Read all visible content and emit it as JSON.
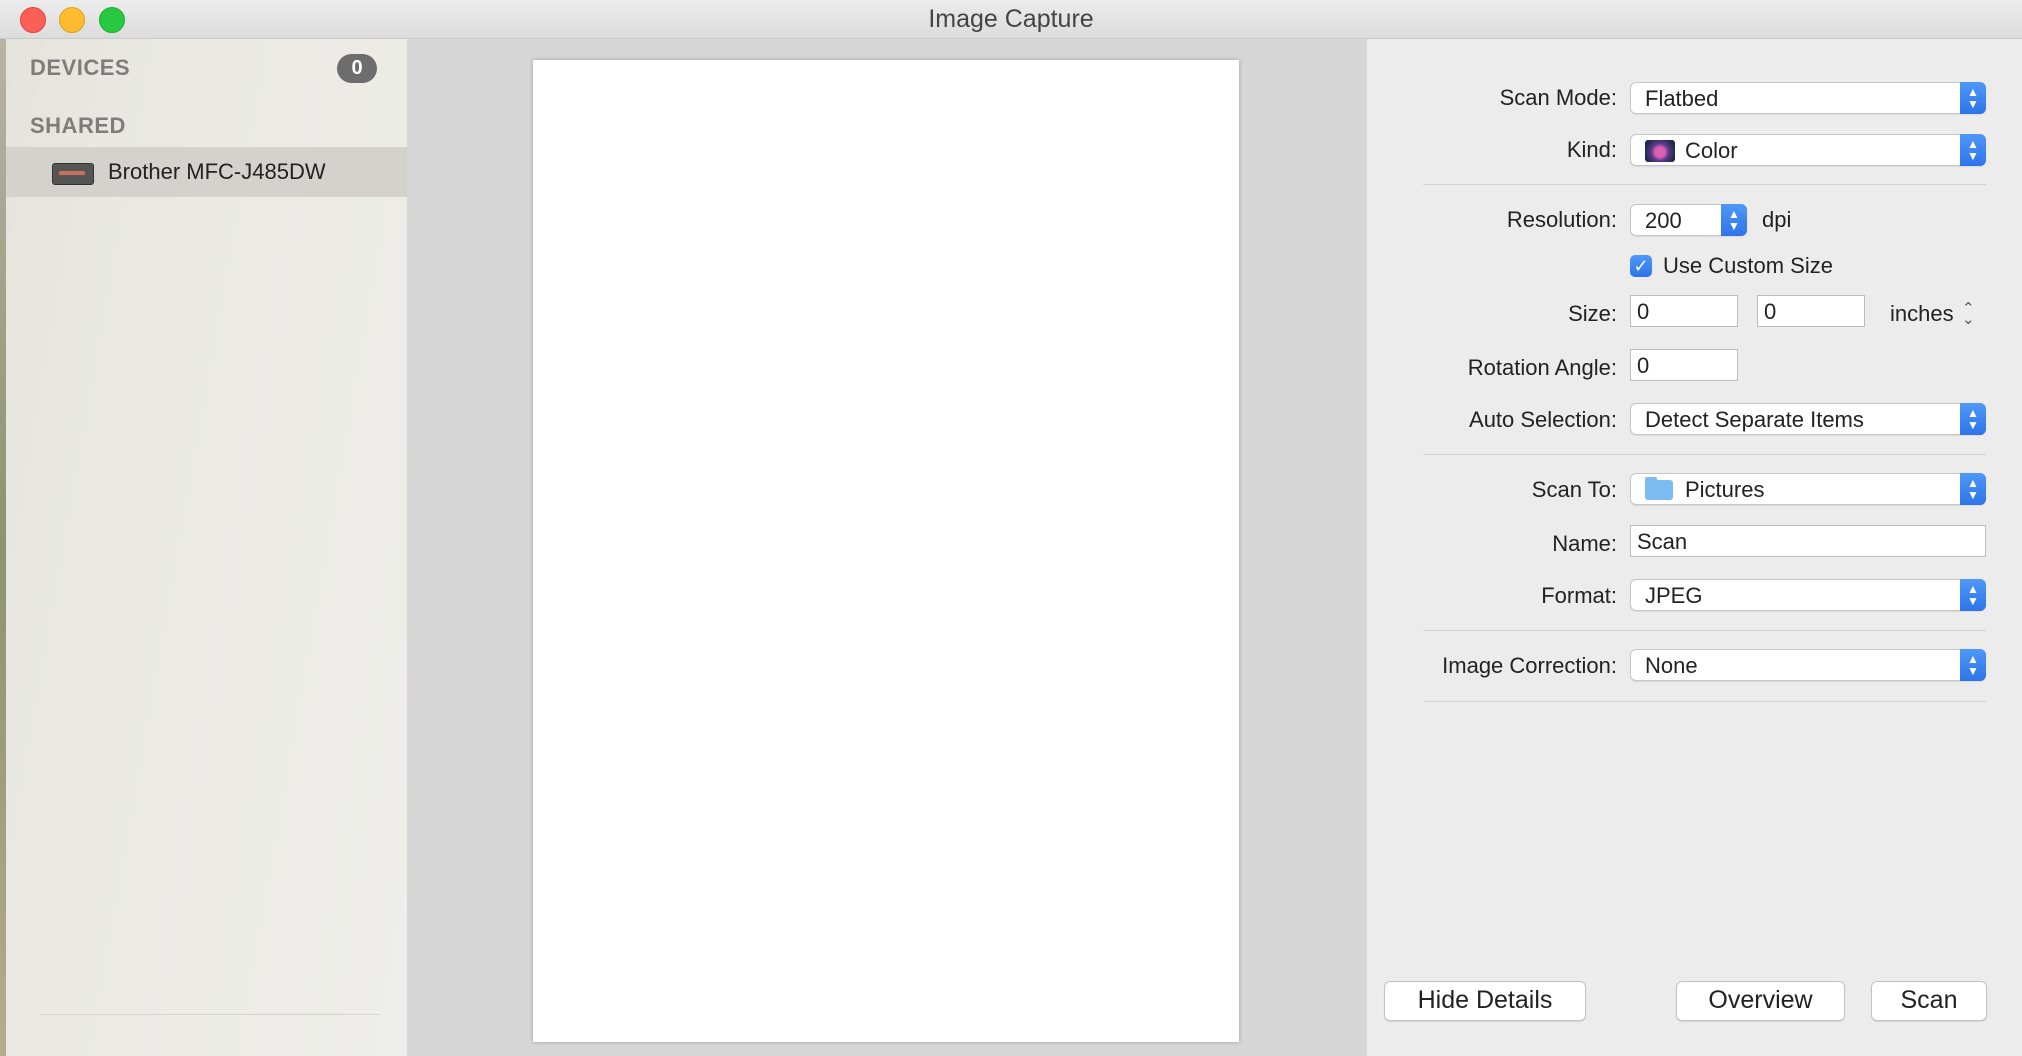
{
  "window": {
    "title": "Image Capture"
  },
  "sidebar": {
    "devices_header": "DEVICES",
    "devices_count": "0",
    "shared_header": "SHARED",
    "shared_items": [
      {
        "label": "Brother MFC-J485DW",
        "icon": "printer-icon"
      }
    ]
  },
  "details": {
    "scan_mode": {
      "label": "Scan Mode:",
      "value": "Flatbed"
    },
    "kind": {
      "label": "Kind:",
      "value": "Color",
      "icon": "color-icon"
    },
    "resolution": {
      "label": "Resolution:",
      "value": "200",
      "unit": "dpi"
    },
    "custom_size": {
      "label": "Use Custom Size",
      "checked": true
    },
    "size": {
      "label": "Size:",
      "width": "0",
      "height": "0",
      "unit": "inches"
    },
    "rotation": {
      "label": "Rotation Angle:",
      "value": "0"
    },
    "auto_selection": {
      "label": "Auto Selection:",
      "value": "Detect Separate Items"
    },
    "scan_to": {
      "label": "Scan To:",
      "value": "Pictures",
      "icon": "folder-icon"
    },
    "name": {
      "label": "Name:",
      "value": "Scan"
    },
    "format": {
      "label": "Format:",
      "value": "JPEG"
    },
    "image_correction": {
      "label": "Image Correction:",
      "value": "None"
    }
  },
  "buttons": {
    "hide_details": "Hide Details",
    "overview": "Overview",
    "scan": "Scan"
  },
  "colors": {
    "accent": "#3b82f0",
    "close": "#fc5f57",
    "minimize": "#fdbc2e",
    "maximize": "#28c840"
  }
}
